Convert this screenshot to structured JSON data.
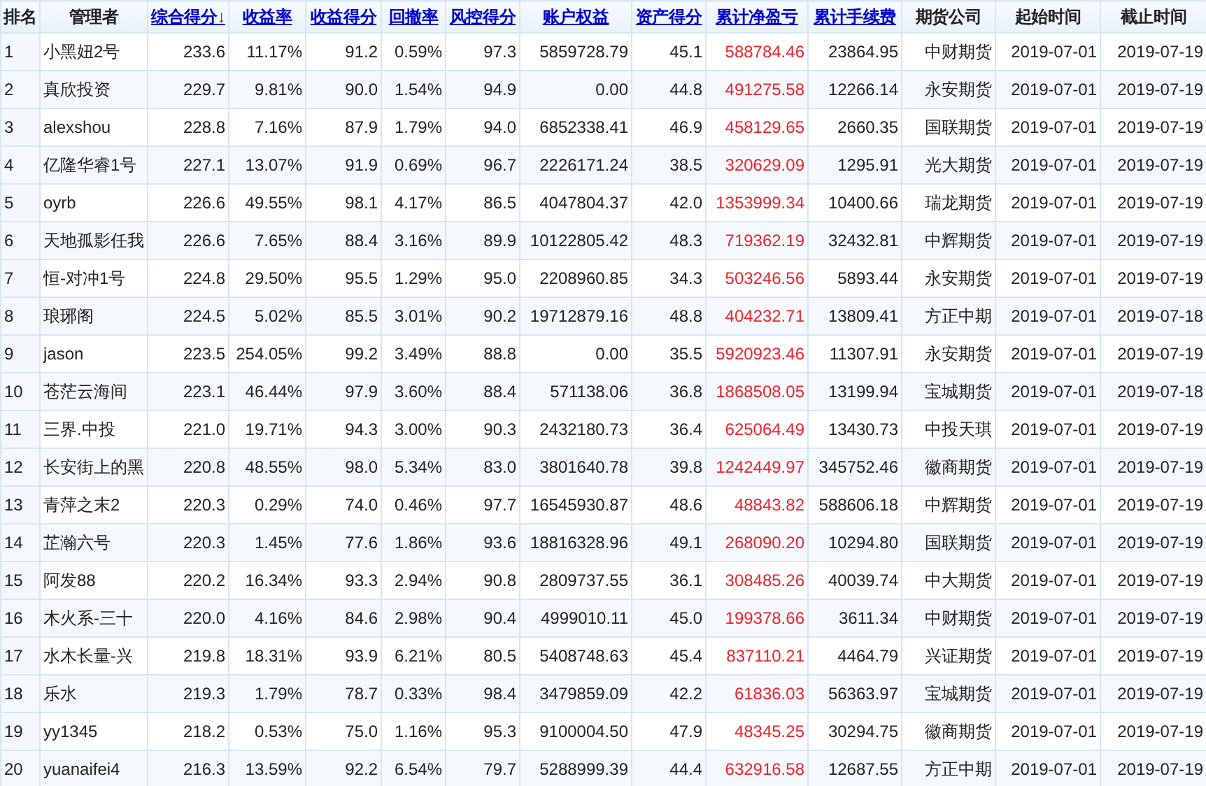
{
  "table": {
    "columns": [
      {
        "label": "排名",
        "kind": "rank",
        "link": false
      },
      {
        "label": "管理者",
        "kind": "name",
        "link": false
      },
      {
        "label": "综合得分",
        "kind": "num",
        "link": true,
        "sort": "↓"
      },
      {
        "label": "收益率",
        "kind": "num",
        "link": true
      },
      {
        "label": "收益得分",
        "kind": "num",
        "link": true
      },
      {
        "label": "回撤率",
        "kind": "num",
        "link": true
      },
      {
        "label": "风控得分",
        "kind": "num",
        "link": true
      },
      {
        "label": "账户权益",
        "kind": "num",
        "link": true
      },
      {
        "label": "资产得分",
        "kind": "num",
        "link": true
      },
      {
        "label": "累计净盈亏",
        "kind": "profit",
        "link": true
      },
      {
        "label": "累计手续费",
        "kind": "num",
        "link": true
      },
      {
        "label": "期货公司",
        "kind": "num",
        "link": false
      },
      {
        "label": "起始时间",
        "kind": "num",
        "link": false
      },
      {
        "label": "截止时间",
        "kind": "num",
        "link": false
      }
    ],
    "rows": [
      [
        "1",
        "小黑妞2号",
        "233.6",
        "11.17%",
        "91.2",
        "0.59%",
        "97.3",
        "5859728.79",
        "45.1",
        "588784.46",
        "23864.95",
        "中财期货",
        "2019-07-01",
        "2019-07-19"
      ],
      [
        "2",
        "真欣投资",
        "229.7",
        "9.81%",
        "90.0",
        "1.54%",
        "94.9",
        "0.00",
        "44.8",
        "491275.58",
        "12266.14",
        "永安期货",
        "2019-07-01",
        "2019-07-19"
      ],
      [
        "3",
        "alexshou",
        "228.8",
        "7.16%",
        "87.9",
        "1.79%",
        "94.0",
        "6852338.41",
        "46.9",
        "458129.65",
        "2660.35",
        "国联期货",
        "2019-07-01",
        "2019-07-19"
      ],
      [
        "4",
        "亿隆华睿1号",
        "227.1",
        "13.07%",
        "91.9",
        "0.69%",
        "96.7",
        "2226171.24",
        "38.5",
        "320629.09",
        "1295.91",
        "光大期货",
        "2019-07-01",
        "2019-07-19"
      ],
      [
        "5",
        "oyrb",
        "226.6",
        "49.55%",
        "98.1",
        "4.17%",
        "86.5",
        "4047804.37",
        "42.0",
        "1353999.34",
        "10400.66",
        "瑞龙期货",
        "2019-07-01",
        "2019-07-19"
      ],
      [
        "6",
        "天地孤影任我",
        "226.6",
        "7.65%",
        "88.4",
        "3.16%",
        "89.9",
        "10122805.42",
        "48.3",
        "719362.19",
        "32432.81",
        "中辉期货",
        "2019-07-01",
        "2019-07-19"
      ],
      [
        "7",
        "恒-对冲1号",
        "224.8",
        "29.50%",
        "95.5",
        "1.29%",
        "95.0",
        "2208960.85",
        "34.3",
        "503246.56",
        "5893.44",
        "永安期货",
        "2019-07-01",
        "2019-07-19"
      ],
      [
        "8",
        "琅琊阁",
        "224.5",
        "5.02%",
        "85.5",
        "3.01%",
        "90.2",
        "19712879.16",
        "48.8",
        "404232.71",
        "13809.41",
        "方正中期",
        "2019-07-01",
        "2019-07-18"
      ],
      [
        "9",
        "jason",
        "223.5",
        "254.05%",
        "99.2",
        "3.49%",
        "88.8",
        "0.00",
        "35.5",
        "5920923.46",
        "11307.91",
        "永安期货",
        "2019-07-01",
        "2019-07-19"
      ],
      [
        "10",
        "苍茫云海间",
        "223.1",
        "46.44%",
        "97.9",
        "3.60%",
        "88.4",
        "571138.06",
        "36.8",
        "1868508.05",
        "13199.94",
        "宝城期货",
        "2019-07-01",
        "2019-07-18"
      ],
      [
        "11",
        "三界.中投",
        "221.0",
        "19.71%",
        "94.3",
        "3.00%",
        "90.3",
        "2432180.73",
        "36.4",
        "625064.49",
        "13430.73",
        "中投天琪",
        "2019-07-01",
        "2019-07-19"
      ],
      [
        "12",
        "长安街上的黑",
        "220.8",
        "48.55%",
        "98.0",
        "5.34%",
        "83.0",
        "3801640.78",
        "39.8",
        "1242449.97",
        "345752.46",
        "徽商期货",
        "2019-07-01",
        "2019-07-19"
      ],
      [
        "13",
        "青萍之末2",
        "220.3",
        "0.29%",
        "74.0",
        "0.46%",
        "97.7",
        "16545930.87",
        "48.6",
        "48843.82",
        "588606.18",
        "中辉期货",
        "2019-07-01",
        "2019-07-19"
      ],
      [
        "14",
        "芷瀚六号",
        "220.3",
        "1.45%",
        "77.6",
        "1.86%",
        "93.6",
        "18816328.96",
        "49.1",
        "268090.20",
        "10294.80",
        "国联期货",
        "2019-07-01",
        "2019-07-19"
      ],
      [
        "15",
        "阿发88",
        "220.2",
        "16.34%",
        "93.3",
        "2.94%",
        "90.8",
        "2809737.55",
        "36.1",
        "308485.26",
        "40039.74",
        "中大期货",
        "2019-07-01",
        "2019-07-19"
      ],
      [
        "16",
        "木火系-三十",
        "220.0",
        "4.16%",
        "84.6",
        "2.98%",
        "90.4",
        "4999010.11",
        "45.0",
        "199378.66",
        "3611.34",
        "中财期货",
        "2019-07-01",
        "2019-07-19"
      ],
      [
        "17",
        "水木长量-兴",
        "219.8",
        "18.31%",
        "93.9",
        "6.21%",
        "80.5",
        "5408748.63",
        "45.4",
        "837110.21",
        "4464.79",
        "兴证期货",
        "2019-07-01",
        "2019-07-19"
      ],
      [
        "18",
        "乐水",
        "219.3",
        "1.79%",
        "78.7",
        "0.33%",
        "98.4",
        "3479859.09",
        "42.2",
        "61836.03",
        "56363.97",
        "宝城期货",
        "2019-07-01",
        "2019-07-19"
      ],
      [
        "19",
        "yy1345",
        "218.2",
        "0.53%",
        "75.0",
        "1.16%",
        "95.3",
        "9100004.50",
        "47.9",
        "48345.25",
        "30294.75",
        "徽商期货",
        "2019-07-01",
        "2019-07-19"
      ],
      [
        "20",
        "yuanaifei4",
        "216.3",
        "13.59%",
        "92.2",
        "6.54%",
        "79.7",
        "5288999.39",
        "44.4",
        "632916.58",
        "12687.55",
        "方正中期",
        "2019-07-01",
        "2019-07-19"
      ]
    ]
  }
}
